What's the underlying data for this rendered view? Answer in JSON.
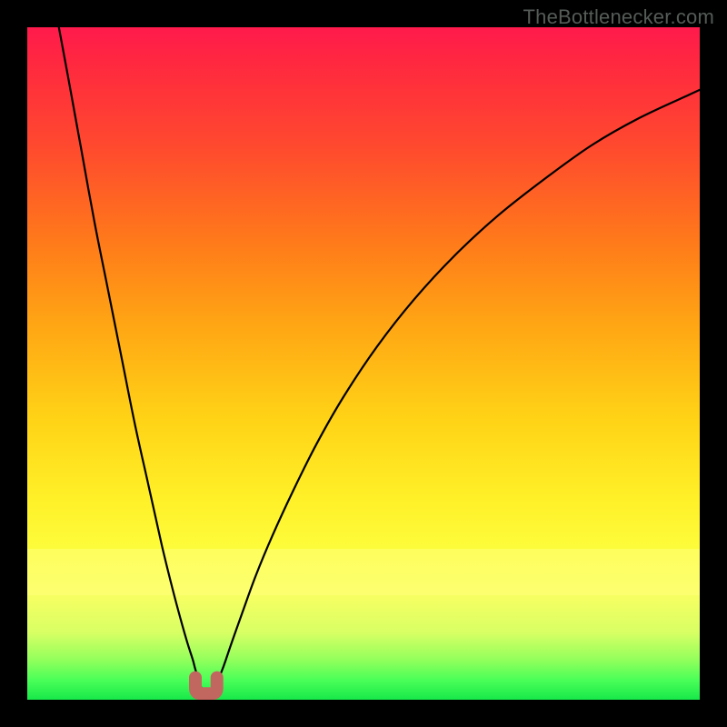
{
  "watermark": "TheBottlenecker.com",
  "colors": {
    "border": "#000000",
    "curve": "#000000",
    "marker": "#c1675f",
    "gradient_top": "#ff1a4c",
    "gradient_bottom": "#17e84a"
  },
  "chart_data": {
    "type": "line",
    "title": "",
    "xlabel": "",
    "ylabel": "",
    "xlim": [
      0,
      100
    ],
    "ylim": [
      0,
      100
    ],
    "note": "x and y are percentages of the plot area; y increases downward (screen coordinates). Two curves share a cusp near the bottom-left and form a V shape.",
    "series": [
      {
        "name": "left-branch",
        "x": [
          4.7,
          6.0,
          8.0,
          10.0,
          12.0,
          14.0,
          16.0,
          18.0,
          20.0,
          21.6,
          22.8,
          23.8,
          24.6,
          25.0,
          25.5,
          25.8,
          26.0
        ],
        "y": [
          0.0,
          7.0,
          18.0,
          29.0,
          39.0,
          49.0,
          59.0,
          68.0,
          77.0,
          83.5,
          88.0,
          91.5,
          94.0,
          95.5,
          97.0,
          98.0,
          98.8
        ]
      },
      {
        "name": "right-branch",
        "x": [
          27.6,
          28.2,
          29.2,
          30.4,
          32.0,
          34.0,
          36.5,
          39.5,
          43.0,
          47.0,
          52.0,
          57.5,
          63.5,
          70.0,
          77.0,
          84.0,
          91.0,
          98.5,
          100.0
        ],
        "y": [
          98.8,
          97.5,
          95.0,
          91.5,
          87.0,
          81.5,
          75.5,
          69.0,
          62.0,
          55.0,
          47.5,
          40.5,
          34.0,
          28.0,
          22.5,
          17.5,
          13.5,
          10.0,
          9.3
        ]
      }
    ],
    "marker": {
      "name": "cusp-marker",
      "shape": "u",
      "x_range": [
        25.0,
        28.2
      ],
      "y": 98.3
    },
    "gradient_bands": [
      {
        "y_pct": 0,
        "color": "#ff1a4c"
      },
      {
        "y_pct": 100,
        "color": "#17e84a"
      }
    ]
  }
}
